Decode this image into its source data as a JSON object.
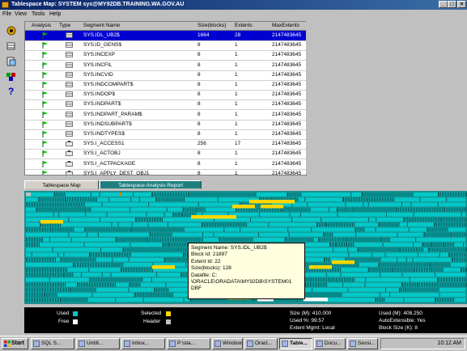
{
  "window": {
    "title": "Tablespace Map: SYSTEM sys@MY92DB.TRAINING.WA.GOV.AU"
  },
  "menu": [
    "File",
    "View",
    "Tools",
    "Help"
  ],
  "grid": {
    "columns": [
      "Analysis",
      "Type",
      "Segment Name",
      "Size(blocks)",
      "Extents",
      "MaxExtents"
    ],
    "rows": [
      {
        "name": "SYS.IDL_UB2$",
        "size": "1664",
        "extents": "28",
        "max": "2147483645",
        "type": "table",
        "selected": true
      },
      {
        "name": "SYS.ID_GENS$",
        "size": "8",
        "extents": "1",
        "max": "2147483645",
        "type": "table"
      },
      {
        "name": "SYS.INCEXP",
        "size": "8",
        "extents": "1",
        "max": "2147483645",
        "type": "table"
      },
      {
        "name": "SYS.INCFIL",
        "size": "8",
        "extents": "1",
        "max": "2147483645",
        "type": "table"
      },
      {
        "name": "SYS.INCVID",
        "size": "8",
        "extents": "1",
        "max": "2147483645",
        "type": "table"
      },
      {
        "name": "SYS.INDCOMPART$",
        "size": "8",
        "extents": "1",
        "max": "2147483645",
        "type": "table"
      },
      {
        "name": "SYS.INDOP$",
        "size": "8",
        "extents": "1",
        "max": "2147483645",
        "type": "table"
      },
      {
        "name": "SYS.INDPART$",
        "size": "8",
        "extents": "1",
        "max": "2147483645",
        "type": "table"
      },
      {
        "name": "SYS.INDPART_PARAM$",
        "size": "8",
        "extents": "1",
        "max": "2147483645",
        "type": "table"
      },
      {
        "name": "SYS.INDSUBPART$",
        "size": "8",
        "extents": "1",
        "max": "2147483645",
        "type": "table"
      },
      {
        "name": "SYS.INDTYPES$",
        "size": "8",
        "extents": "1",
        "max": "2147483645",
        "type": "table"
      },
      {
        "name": "SYS.I_ACCESS1",
        "size": "256",
        "extents": "17",
        "max": "2147483645",
        "type": "index"
      },
      {
        "name": "SYS.I_ACTOBJ",
        "size": "8",
        "extents": "1",
        "max": "2147483645",
        "type": "index"
      },
      {
        "name": "SYS.I_ACTPACKAGE",
        "size": "8",
        "extents": "1",
        "max": "2147483645",
        "type": "index"
      },
      {
        "name": "SYS.I_APPLY_DEST_OBJ1",
        "size": "8",
        "extents": "1",
        "max": "2147483645",
        "type": "index"
      }
    ]
  },
  "tabs": [
    "Tablespace Map",
    "Tablespace Analysis Report"
  ],
  "tooltip": {
    "segment": "Segment Name: SYS.IDL_UB2$",
    "block": "Block Id: 21897",
    "extent": "Extent Id: 22",
    "size": "Size(blocks): 128",
    "datafile": "Datafile: C:",
    "path1": "\\ORACLE\\ORADATA\\MY92DB\\SYSTEM01",
    "path2": "DBF"
  },
  "legend": {
    "used": "Used",
    "free": "Free",
    "selected": "Selected",
    "header": "Header",
    "size_m": "Size (M): 410.000",
    "used_pct": "Used %: 99.57",
    "extent_mgmt": "Extent Mgmt: Local",
    "used_m": "Used (M): 408.250",
    "autoext": "AutoExtensible: Yes",
    "block_size": "Block Size (K): 8",
    "colors": {
      "used": "#00c8c8",
      "free": "#ffffff",
      "selected": "#ffd700",
      "header": "#c0c0c0"
    }
  },
  "taskbar": {
    "start": "Start",
    "buttons": [
      "SQL S...",
      "Untitl...",
      "Inbox...",
      "P:\\sta...",
      "Windows",
      "Oracl...",
      "Table...",
      "Docu...",
      "Sessi..."
    ],
    "clock": "10:12 AM"
  }
}
